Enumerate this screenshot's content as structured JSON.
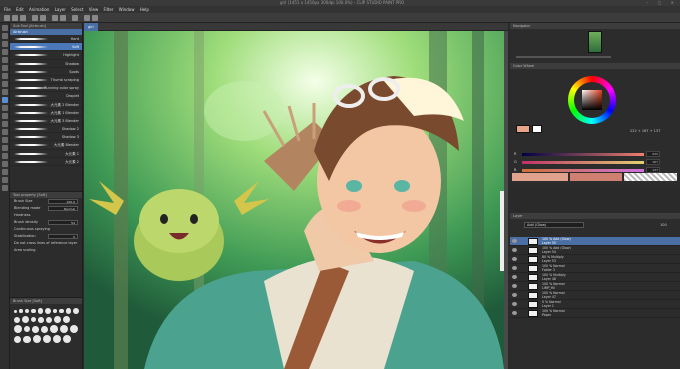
{
  "title": "girl (1451 x 1450px 300dpi 100.0%) - CLIP STUDIO PAINT PRO",
  "menu": [
    "File",
    "Edit",
    "Animation",
    "Layer",
    "Select",
    "View",
    "Filter",
    "Window",
    "Help"
  ],
  "canvas_tab": "girl",
  "subtool": {
    "header": "Sub Tool [Airbrush]",
    "group": "Airbrush",
    "items": [
      "Hard",
      "Soft",
      "Highlight",
      "Shadow",
      "Spots",
      "Thumb scraping",
      "Running color spray",
      "Droplet",
      "大元素 2 Blender",
      "大元素 1 Blender",
      "大元素 3 Blender",
      "Shadow 2",
      "Shadow 3",
      "大元素 Blender",
      "大元素 1",
      "大元素 2"
    ],
    "selected_index": 1
  },
  "tool_property": {
    "header": "Tool property [Soft]",
    "items": [
      {
        "label": "Brush Size",
        "value": "100.0"
      },
      {
        "label": "Blending mode",
        "value": "Normal"
      },
      {
        "label": "Hardness",
        "value": ""
      },
      {
        "label": "Brush density",
        "value": "54"
      },
      {
        "label": "Continuous spraying",
        "value": ""
      },
      {
        "label": "Stabilization",
        "value": "0"
      },
      {
        "label": "Do not cross lines of reference layer",
        "value": ""
      },
      {
        "label": "Area scaling",
        "value": ""
      }
    ]
  },
  "brush_size": {
    "header": "Brush Size [Soft]"
  },
  "navigator": {
    "header": "Navigator"
  },
  "color_wheel": {
    "header": "Color Wheel",
    "readout": "222 + 167 + 137"
  },
  "rgb": {
    "r": "222",
    "g": "167",
    "b": "137"
  },
  "layers": {
    "tabs": "Layer",
    "mode": "Add (Glow)",
    "opacity": "100",
    "rows": [
      {
        "a": "100 % Add (Glow)",
        "b": "Layer 55",
        "sel": true
      },
      {
        "a": "100 % Add (Glow)",
        "b": "Layer 54",
        "sel": false
      },
      {
        "a": "80 % Multiply",
        "b": "Layer 53",
        "sel": false
      },
      {
        "a": "100 % Normal",
        "b": "Folder 3",
        "sel": false
      },
      {
        "a": "100 % Multiply",
        "b": "Layer 48",
        "sel": false
      },
      {
        "a": "100 % Normal",
        "b": "LIMP_fill",
        "sel": false
      },
      {
        "a": "100 % Normal",
        "b": "Layer 47",
        "sel": false
      },
      {
        "a": "0 % Normal",
        "b": "Layer 1",
        "sel": false
      },
      {
        "a": "100 % Normal",
        "b": "Paper",
        "sel": false
      }
    ]
  }
}
